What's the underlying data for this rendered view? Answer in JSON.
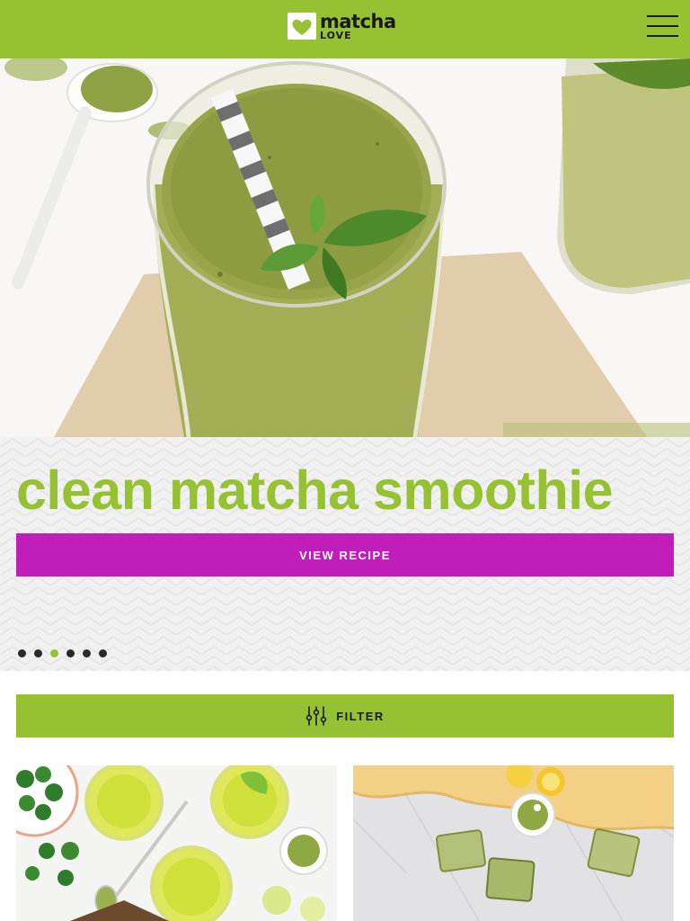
{
  "header": {
    "logo_line1": "matcha",
    "logo_line2": "LOVE",
    "logo_mark": "heart-logo-icon",
    "menu_icon": "hamburger-menu-icon"
  },
  "hero": {
    "image": "matcha smoothie in glass with striped straw and mint",
    "title": "clean matcha smoothie",
    "cta_label": "VIEW RECIPE",
    "slide_count": 6,
    "active_slide": 3
  },
  "filter": {
    "label": "FILTER",
    "icon": "sliders-icon"
  },
  "recipe_cards": [
    {
      "image": "green matcha drinks with jalapenos and lime"
    },
    {
      "image": "matcha lemon bars on marble"
    }
  ],
  "colors": {
    "brand_green": "#95c132",
    "cta_magenta": "#c11dbb",
    "text_dark": "#1a1a1a"
  }
}
